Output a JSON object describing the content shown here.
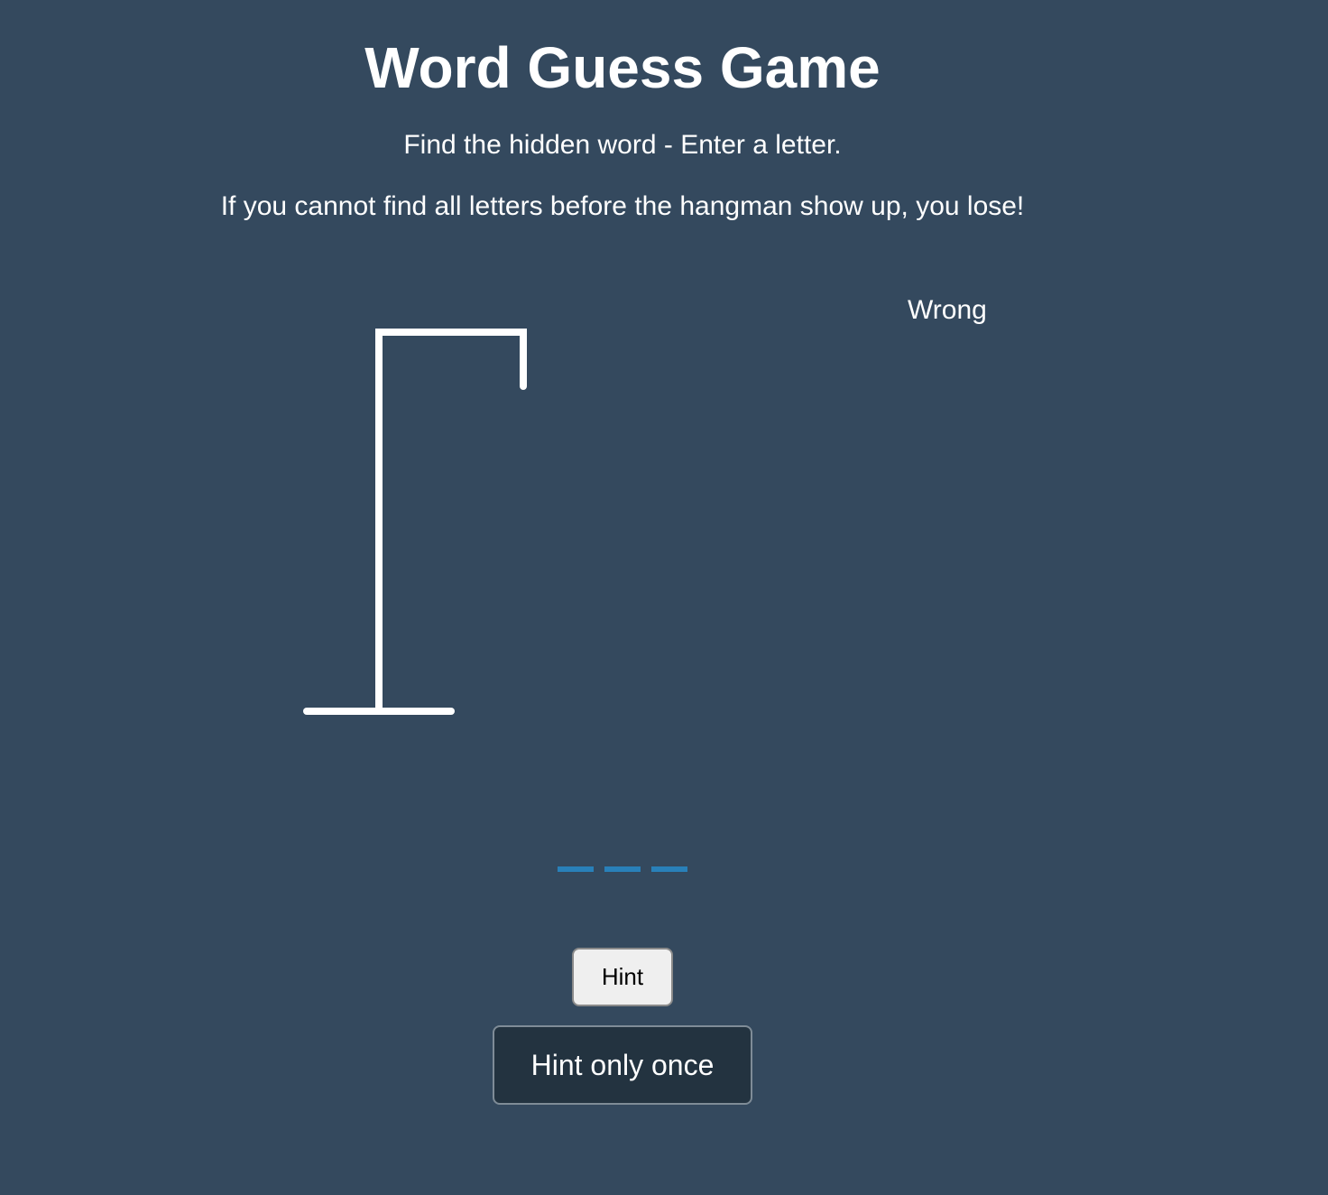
{
  "header": {
    "title": "Word Guess Game",
    "instruction": "Find the hidden word - Enter a letter.",
    "warning": "If you cannot find all letters before the hangman show up, you lose!"
  },
  "wrong_letters": {
    "label": "Wrong",
    "letters": []
  },
  "word": {
    "slot_count": 3,
    "revealed": [
      "",
      "",
      ""
    ]
  },
  "hint": {
    "button_label": "Hint",
    "message": "Hint only once"
  },
  "colors": {
    "background": "#34495e",
    "slot": "#2980b9",
    "gallows": "#ffffff"
  },
  "hangman_stage": 0
}
